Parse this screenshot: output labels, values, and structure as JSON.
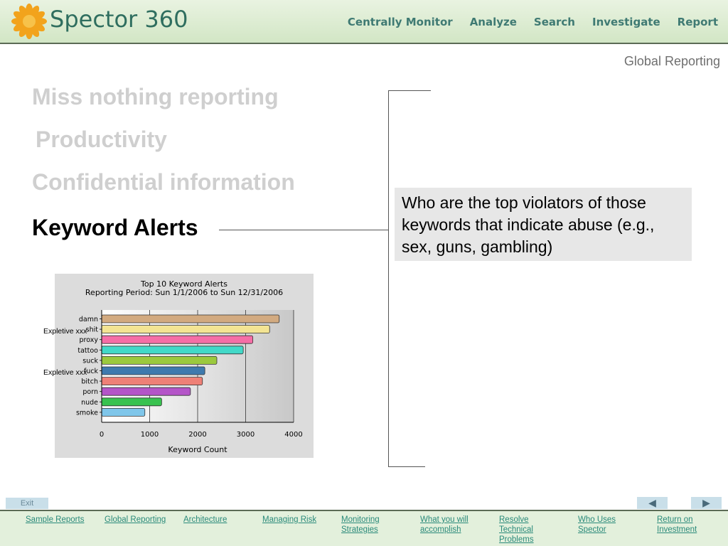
{
  "app": {
    "logo_text": "Spector 360",
    "logo_icon": "sunflower-logo-icon",
    "top_nav": [
      "Centrally Monitor",
      "Analyze",
      "Search",
      "Investigate",
      "Report"
    ]
  },
  "section_label": "Global Reporting",
  "topics": [
    "Miss nothing reporting",
    "Productivity",
    "Confidential information",
    "Keyword Alerts"
  ],
  "active_topic": "Keyword Alerts",
  "callout_text": "Who are the top violators of those keywords that indicate abuse (e.g., sex, guns, gambling)",
  "chart_notes": [
    "Expletive xxx",
    "Expletive xxx"
  ],
  "chart_data": {
    "type": "bar",
    "orientation": "horizontal",
    "title": "Top 10 Keyword Alerts",
    "subtitle": "Reporting Period: Sun 1/1/2006 to Sun 12/31/2006",
    "xlabel": "Keyword Count",
    "ylabel": "",
    "xlim": [
      0,
      4000
    ],
    "xticks": [
      0,
      1000,
      2000,
      3000,
      4000
    ],
    "grid": true,
    "categories": [
      "damn",
      "shit",
      "proxy",
      "tattoo",
      "suck",
      "fuck",
      "bitch",
      "porn",
      "nude",
      "smoke"
    ],
    "values": [
      3700,
      3500,
      3150,
      2950,
      2400,
      2150,
      2100,
      1850,
      1250,
      900
    ],
    "colors": [
      "#d2aa80",
      "#f3e493",
      "#f56ea6",
      "#42d9c8",
      "#9bc93e",
      "#3e7aae",
      "#ee8077",
      "#b455c8",
      "#38c24f",
      "#7fc6ea"
    ]
  },
  "controls": {
    "exit_label": "Exit",
    "prev_label": "◀",
    "next_label": "▶"
  },
  "footer_links": [
    "Sample Reports",
    "Global Reporting",
    "Architecture",
    "Managing Risk",
    "Monitoring\nStrategies",
    "What you will\naccomplish",
    "Resolve\nTechnical\nProblems",
    "Who Uses\nSpector",
    "Return on\nInvestment"
  ]
}
